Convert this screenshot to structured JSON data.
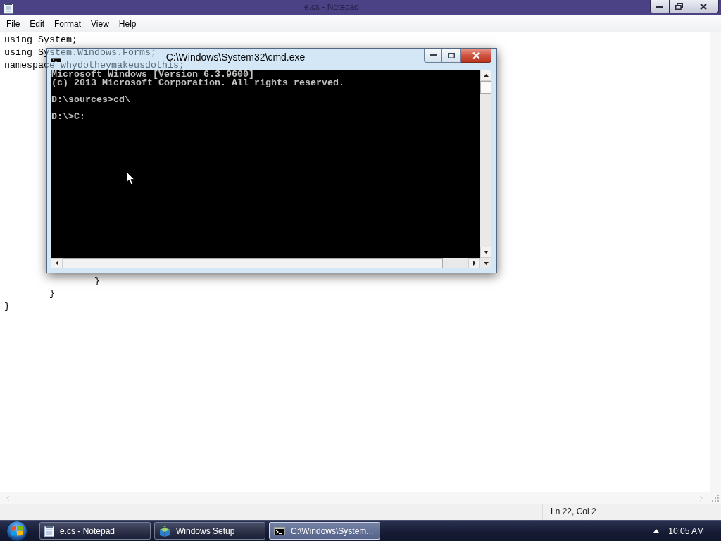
{
  "notepad": {
    "title": "e.cs - Notepad",
    "menu": [
      "File",
      "Edit",
      "Format",
      "View",
      "Help"
    ],
    "lines_top": [
      "using System;",
      "using System.Windows.Forms;",
      "namespace whydotheymakeusdothis;"
    ],
    "lines_bottom": [
      "\t\t}",
      "\t}",
      "}"
    ],
    "status": "Ln 22, Col 2"
  },
  "console_window": {
    "title": "C:\\Windows\\System32\\cmd.exe",
    "blocks": [
      [
        "Microsoft Windows [Version 6.3.9600]",
        "(c) 2013 Microsoft Corporation. All rights reserved."
      ],
      [
        "D:\\sources>cd\\"
      ],
      [
        "D:\\>C:"
      ]
    ]
  },
  "taskbar": {
    "buttons": [
      {
        "kind": "notepad",
        "label": "e.cs - Notepad",
        "selected": false
      },
      {
        "kind": "setup",
        "label": "Windows Setup",
        "selected": false
      },
      {
        "kind": "console",
        "label": "C:\\Windows\\System...",
        "selected": true
      }
    ],
    "clock": "10:05 AM"
  }
}
